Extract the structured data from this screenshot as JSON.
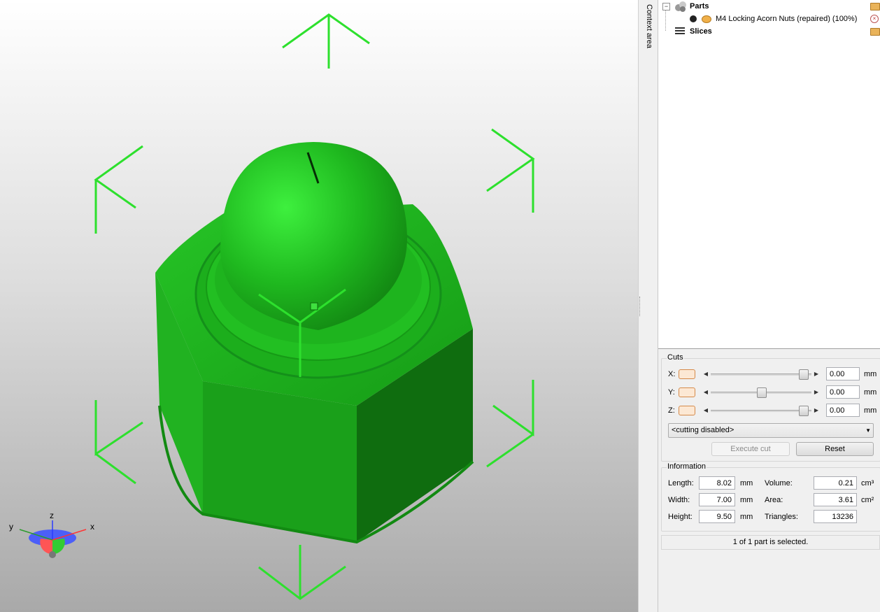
{
  "tree": {
    "parts_label": "Parts",
    "part_label": "M4 Locking Acorn Nuts (repaired) (100%)",
    "slices_label": "Slices",
    "expander_symbol": "−"
  },
  "context_tab_label": "Context area",
  "gizmo": {
    "x": "x",
    "y": "y",
    "z": "z"
  },
  "cuts": {
    "title": "Cuts",
    "rows": [
      {
        "axis": "X:",
        "value": "0.00",
        "unit": "mm",
        "slider_position": 0.95
      },
      {
        "axis": "Y:",
        "value": "0.00",
        "unit": "mm",
        "slider_position": 0.5
      },
      {
        "axis": "Z:",
        "value": "0.00",
        "unit": "mm",
        "slider_position": 0.95
      }
    ],
    "mode": "<cutting disabled>",
    "execute_label": "Execute cut",
    "reset_label": "Reset"
  },
  "info": {
    "title": "Information",
    "length_label": "Length:",
    "length_value": "8.02",
    "length_unit": "mm",
    "width_label": "Width:",
    "width_value": "7.00",
    "width_unit": "mm",
    "height_label": "Height:",
    "height_value": "9.50",
    "height_unit": "mm",
    "volume_label": "Volume:",
    "volume_value": "0.21",
    "volume_unit": "cm³",
    "area_label": "Area:",
    "area_value": "3.61",
    "area_unit": "cm²",
    "triangles_label": "Triangles:",
    "triangles_value": "13236"
  },
  "status": "1 of 1 part is selected.",
  "colors": {
    "model": "#22c322",
    "bracket": "#33e033",
    "swatch_border": "#d58a4a"
  }
}
